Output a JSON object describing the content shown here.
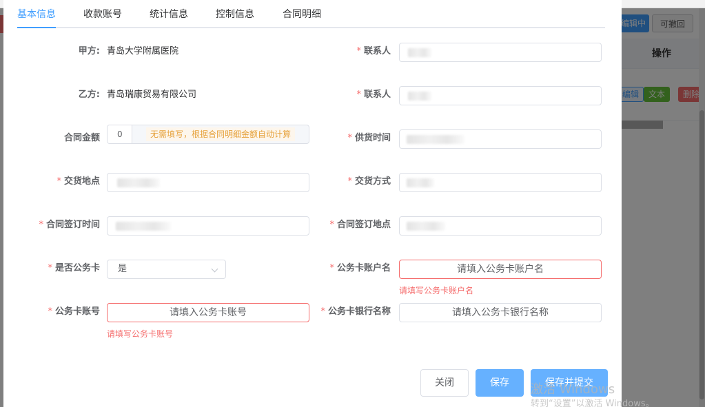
{
  "background": {
    "btn_editing": "编辑中",
    "btn_revocable": "可撤回",
    "col_operation": "操作",
    "tag_edit": "编辑",
    "tag_text": "文本",
    "tag_delete": "删除"
  },
  "tabs": [
    {
      "label": "基本信息",
      "active": true
    },
    {
      "label": "收款账号",
      "active": false
    },
    {
      "label": "统计信息",
      "active": false
    },
    {
      "label": "控制信息",
      "active": false
    },
    {
      "label": "合同明细",
      "active": false
    }
  ],
  "form": {
    "party_a_label": "甲方:",
    "party_a_value": "青岛大学附属医院",
    "party_b_label": "乙方:",
    "party_b_value": "青岛瑞康贸易有限公司",
    "contact1_label": "联系人",
    "contact2_label": "联系人",
    "amount_label": "合同金额",
    "amount_value": "0",
    "amount_hint": "无需填写，根据合同明细金额自动计算",
    "supply_time_label": "供货时间",
    "delivery_place_label": "交货地点",
    "delivery_method_label": "交货方式",
    "sign_time_label": "合同签订时间",
    "sign_place_label": "合同签订地点",
    "is_card_label": "是否公务卡",
    "is_card_value": "是",
    "card_account_name_label": "公务卡账户名",
    "card_account_name_placeholder": "请填入公务卡账户名",
    "card_account_name_error": "请填写公务卡账户名",
    "card_no_label": "公务卡账号",
    "card_no_placeholder": "请填入公务卡账号",
    "card_no_error": "请填写公务卡账号",
    "card_bank_label": "公务卡银行名称",
    "card_bank_placeholder": "请填入公务卡银行名称"
  },
  "buttons": {
    "close": "关闭",
    "save": "保存",
    "save_submit": "保存并提交"
  },
  "watermark": {
    "line1": "激活 Windows",
    "line2": "转到“设置”以激活 Windows。"
  },
  "colors": {
    "primary": "#409eff",
    "error": "#f56c6c",
    "warning": "#e6a23c"
  }
}
